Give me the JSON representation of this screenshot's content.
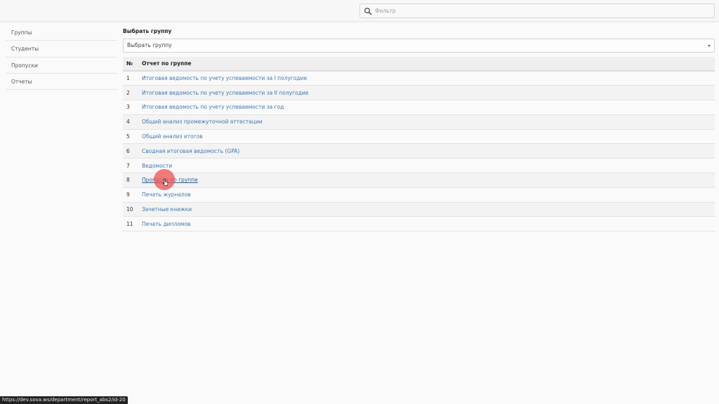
{
  "search": {
    "placeholder": "Фильтр",
    "value": ""
  },
  "sidebar": {
    "items": [
      {
        "label": "Группы"
      },
      {
        "label": "Студенты"
      },
      {
        "label": "Пропуски"
      },
      {
        "label": "Отчеты"
      }
    ]
  },
  "main": {
    "select_label": "Выбрать группу",
    "select_value": "Выбрать группу",
    "table": {
      "headers": [
        "№",
        "Отчет по группе"
      ],
      "rows": [
        {
          "num": "1",
          "title": "Итоговая ведомость по учету успеваемости за I полугодие"
        },
        {
          "num": "2",
          "title": "Итоговая ведомость по учету успеваемости за II полугодие"
        },
        {
          "num": "3",
          "title": "Итоговая ведомость по учету успеваемости за год"
        },
        {
          "num": "4",
          "title": "Общий анализ промежуточной аттестации"
        },
        {
          "num": "5",
          "title": "Общий анализ итогов"
        },
        {
          "num": "6",
          "title": "Сводная итоговая ведомость (GPA)"
        },
        {
          "num": "7",
          "title": "Ведомости"
        },
        {
          "num": "8",
          "title": "Пропуски по группе"
        },
        {
          "num": "9",
          "title": "Печать журналов"
        },
        {
          "num": "10",
          "title": "Зачетные книжки"
        },
        {
          "num": "11",
          "title": "Печать дипломов"
        }
      ]
    }
  },
  "status_url": "https://dev.sova.ws/department/report_abs2/id-20",
  "colors": {
    "link": "#3c78b4",
    "cursor_highlight": "#f05050"
  },
  "icons": [
    "search-icon",
    "dropdown-caret-icon",
    "mouse-pointer-icon"
  ]
}
